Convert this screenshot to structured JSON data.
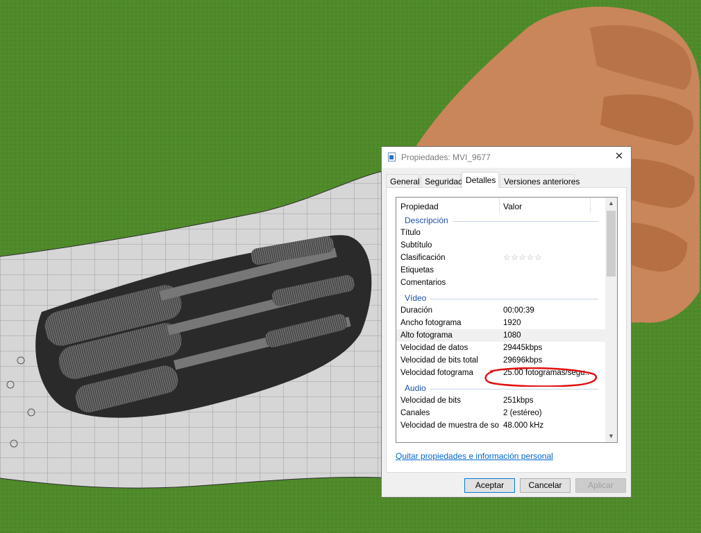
{
  "dialog": {
    "title": "Propiedades: MVI_9677",
    "close_glyph": "✕",
    "tabs": [
      {
        "label": "General",
        "active": false
      },
      {
        "label": "Seguridad",
        "active": false
      },
      {
        "label": "Detalles",
        "active": true
      },
      {
        "label": "Versiones anteriores",
        "active": false
      }
    ],
    "columns": {
      "property": "Propiedad",
      "value": "Valor"
    },
    "groups": {
      "description": {
        "label": "Descripción",
        "rows": [
          {
            "name": "Título",
            "value": ""
          },
          {
            "name": "Subtítulo",
            "value": ""
          },
          {
            "name": "Clasificación",
            "value": "☆☆☆☆☆"
          },
          {
            "name": "Etiquetas",
            "value": ""
          },
          {
            "name": "Comentarios",
            "value": ""
          }
        ]
      },
      "video": {
        "label": "Vídeo",
        "rows": [
          {
            "name": "Duración",
            "value": "00:00:39"
          },
          {
            "name": "Ancho fotograma",
            "value": "1920"
          },
          {
            "name": "Alto fotograma",
            "value": "1080"
          },
          {
            "name": "Velocidad de datos",
            "value": "29445kbps"
          },
          {
            "name": "Velocidad de bits total",
            "value": "29696kbps"
          },
          {
            "name": "Velocidad fotograma",
            "value": "25.00 fotogramas/segu..."
          }
        ]
      },
      "audio": {
        "label": "Audio",
        "rows": [
          {
            "name": "Velocidad de bits",
            "value": "251kbps"
          },
          {
            "name": "Canales",
            "value": "2 (estéreo)"
          },
          {
            "name": "Velocidad de muestra de so...",
            "value": "48.000 kHz"
          }
        ]
      }
    },
    "remove_link": "Quitar propiedades e información personal",
    "buttons": {
      "accept": "Aceptar",
      "cancel": "Cancelar",
      "apply": "Aplicar"
    },
    "scroll_up_glyph": "▲",
    "scroll_down_glyph": "▼",
    "selected_row": "Alto fotograma",
    "colors": {
      "accent": "#0078d7",
      "group_text": "#1e4fa5",
      "annotation": "#e01010",
      "background_green": "#4f8a2a"
    }
  }
}
